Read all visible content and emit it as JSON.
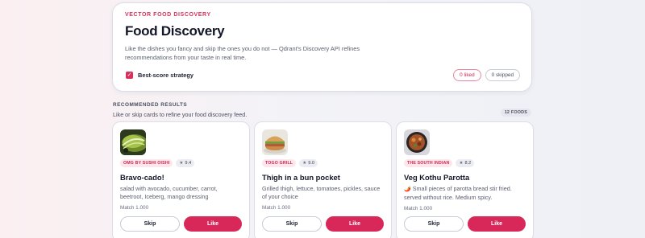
{
  "hero": {
    "eyebrow": "VECTOR FOOD DISCOVERY",
    "title": "Food Discovery",
    "description": "Like the dishes you fancy and skip the ones you do not — Qdrant's Discovery API refines recommendations from your taste in real time.",
    "strategy_checked": true,
    "strategy_label": "Best-score strategy",
    "liked_label": "0 liked",
    "skipped_label": "0 skipped"
  },
  "results": {
    "title": "RECOMMENDED RESULTS",
    "subtitle": "Like or skip cards to refine your food discovery feed.",
    "count_label": "12 FOODS"
  },
  "cards": [
    {
      "image_icon": "avocado-dish-photo",
      "restaurant": "OMG BY SUSHI OISHI",
      "rating": "9.4",
      "name": "Bravo-cado!",
      "description": "salad with avocado, cucumber, carrot, beetroot, Iceberg, mango dressing",
      "match": "Match 1.000",
      "skip_label": "Skip",
      "like_label": "Like"
    },
    {
      "image_icon": "burger-dish-photo",
      "restaurant": "TOGO GRILL",
      "rating": "9.0",
      "name": "Thigh in a bun pocket",
      "description": "Grilled thigh, lettuce, tomatoes, pickles, sauce of your choice",
      "match": "Match 1.000",
      "skip_label": "Skip",
      "like_label": "Like"
    },
    {
      "image_icon": "curry-dish-photo",
      "restaurant": "THE SOUTH INDIAN",
      "rating": "8.2",
      "name": "Veg Kothu Parotta",
      "description_prefix": "🌶️",
      "description": "Small pieces of parotta bread stir fried. served without rice. Medium spicy.",
      "match": "Match 1.000",
      "skip_label": "Skip",
      "like_label": "Like"
    }
  ],
  "colors": {
    "accent": "#d8285a",
    "accent_soft": "#fde6ec",
    "text": "#1f2233",
    "muted": "#5a5e70"
  }
}
